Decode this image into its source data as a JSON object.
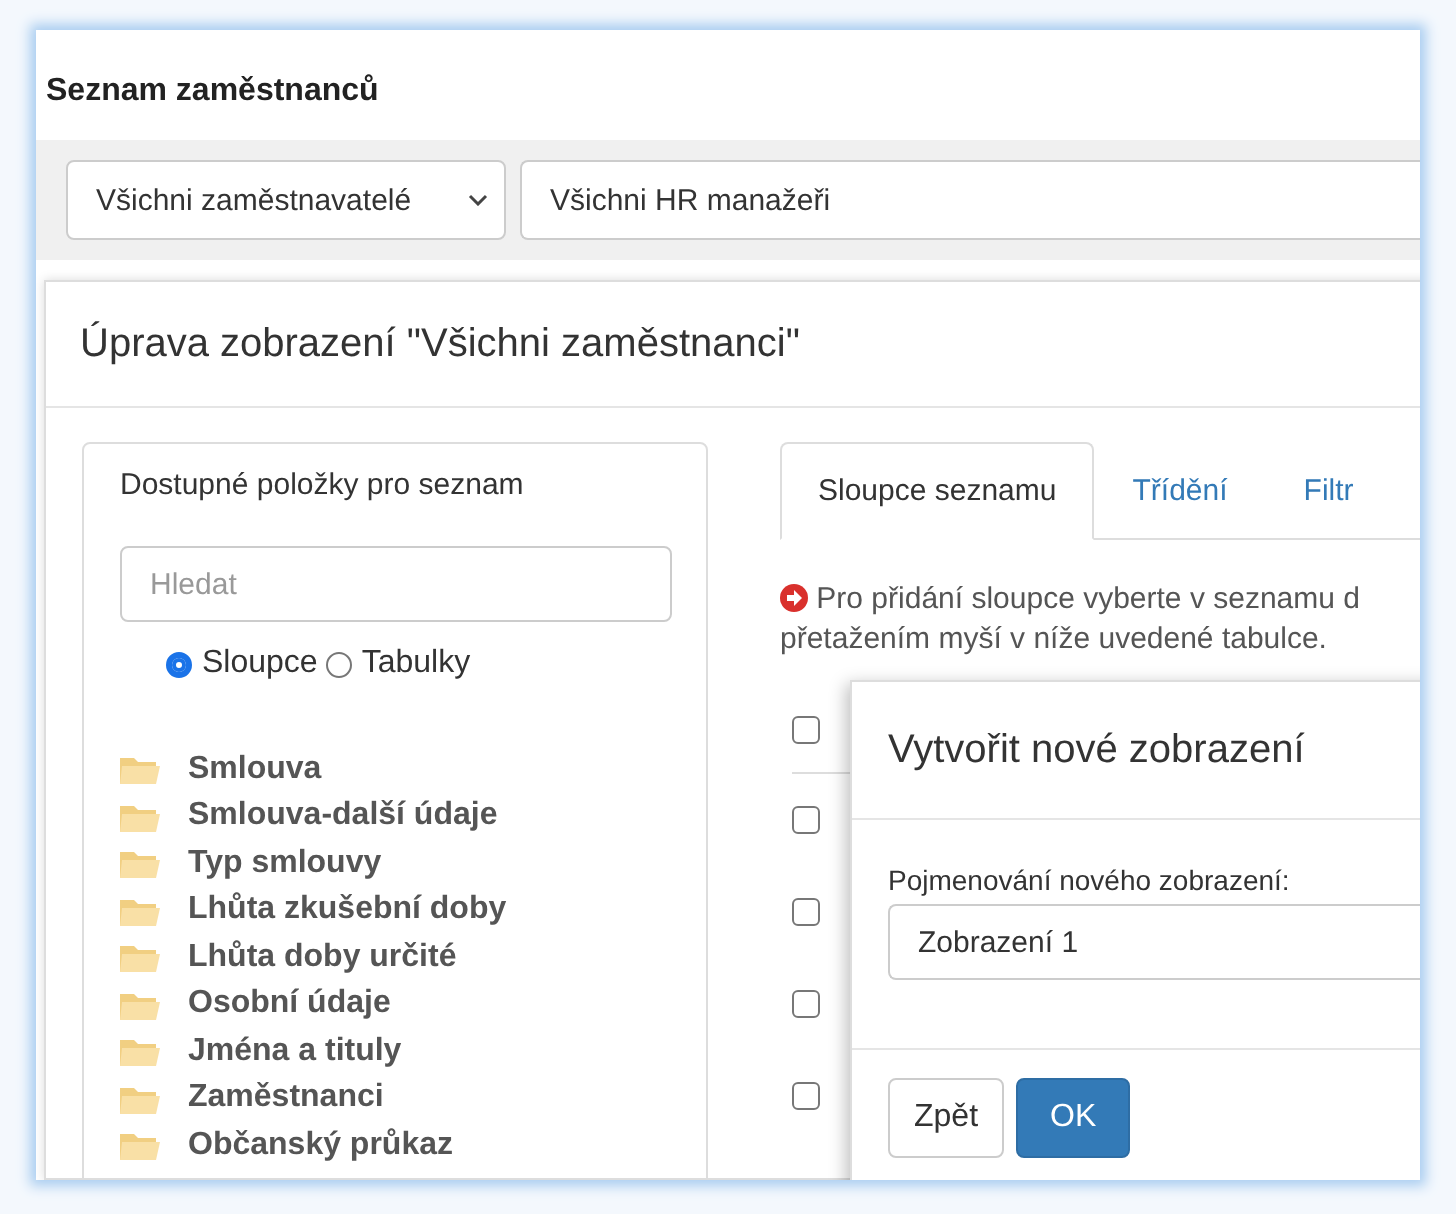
{
  "page": {
    "title": "Seznam zaměstnanců"
  },
  "toolbar": {
    "employer_select": {
      "value": "Všichni zaměstnavatelé"
    },
    "hr_field": {
      "value": "Všichni HR manažeři"
    }
  },
  "edit_view_dialog": {
    "title": "Úprava zobrazení \"Všichni zaměstnanci\"",
    "available_panel": {
      "title": "Dostupné položky pro seznam",
      "search": {
        "placeholder": "Hledat"
      },
      "mode_options": [
        {
          "label": "Sloupce",
          "selected": true
        },
        {
          "label": "Tabulky",
          "selected": false
        }
      ],
      "folders": [
        "Smlouva",
        "Smlouva-další údaje",
        "Typ smlouvy",
        "Lhůta zkušební doby",
        "Lhůta doby určité",
        "Osobní údaje",
        "Jména a tituly",
        "Zaměstnanci",
        "Občanský průkaz"
      ]
    },
    "tabs": [
      {
        "label": "Sloupce seznamu",
        "selected": true
      },
      {
        "label": "Třídění",
        "selected": false
      },
      {
        "label": "Filtr",
        "selected": false
      }
    ],
    "info_lines": [
      "Pro přidání sloupce vyberte v seznamu d",
      "přetažením myší v níže uvedené tabulce."
    ],
    "rows": [
      {
        "checked": false
      },
      {
        "checked": false
      },
      {
        "checked": false
      },
      {
        "checked": false
      },
      {
        "checked": false
      }
    ]
  },
  "new_view_dialog": {
    "title": "Vytvořit nové zobrazení",
    "label": "Pojmenování nového zobrazení:",
    "name_field": {
      "value": "Zobrazení 1"
    },
    "buttons": [
      {
        "label": "Zpět",
        "kind": "default"
      },
      {
        "label": "OK",
        "kind": "primary"
      }
    ]
  }
}
